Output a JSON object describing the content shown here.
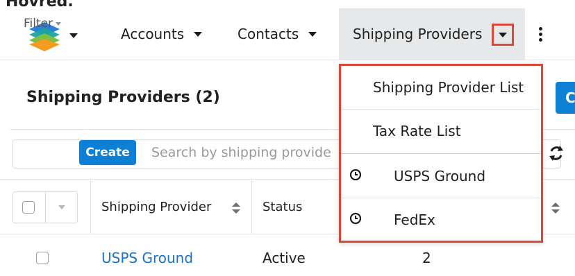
{
  "fragment_text": "Hovred.",
  "nav": {
    "items": [
      {
        "label": "Accounts"
      },
      {
        "label": "Contacts"
      },
      {
        "label": "Shipping Providers"
      }
    ],
    "logo_icon": "sugar-cube-logo-icon",
    "more_icon": "kebab-vertical-icon"
  },
  "dropdown": {
    "items": [
      {
        "label": "Shipping Provider List"
      },
      {
        "label": "Tax Rate List"
      },
      {
        "label": "USPS Ground",
        "icon": "clock-icon"
      },
      {
        "label": "FedEx",
        "icon": "clock-icon"
      }
    ]
  },
  "page": {
    "title": "Shipping Providers (2)",
    "create_partial": "C"
  },
  "filterbar": {
    "filter_label": "Filter",
    "create_label": "Create",
    "search_placeholder": "Search by shipping provide"
  },
  "table": {
    "headers": [
      "Shipping Provider",
      "Status"
    ],
    "rows": [
      {
        "name": "USPS Ground",
        "status": "Active",
        "count": "2"
      }
    ]
  },
  "colors": {
    "accent": "#0d7fd5",
    "highlight_border": "#d64a37",
    "link": "#1a73c9"
  }
}
